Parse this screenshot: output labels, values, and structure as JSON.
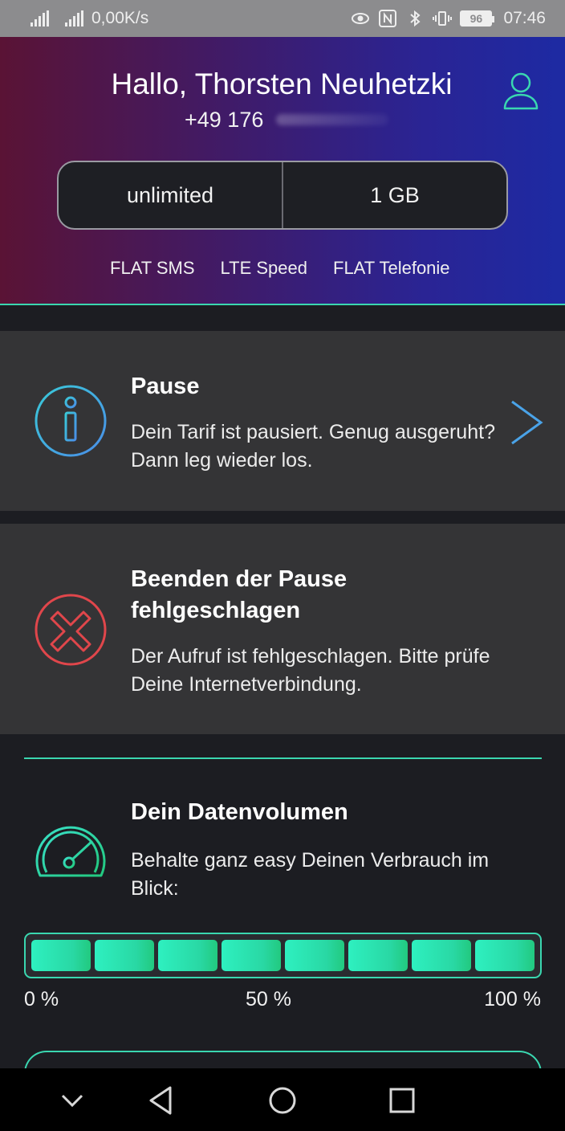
{
  "status_bar": {
    "speed": "0,00K/s",
    "battery": "96",
    "time": "07:46"
  },
  "header": {
    "greeting": "Hallo, Thorsten Neuhetzki",
    "phone": "+49 176",
    "plan": {
      "sms": "unlimited",
      "data": "1 GB"
    },
    "features": [
      "FLAT SMS",
      "LTE Speed",
      "FLAT Telefonie"
    ]
  },
  "cards": {
    "pause": {
      "title": "Pause",
      "text": "Dein Tarif ist pausiert. Genug ausgeruht? Dann leg wieder los."
    },
    "error": {
      "title": "Beenden der Pause fehlgeschlagen",
      "text": "Der Aufruf ist fehlgeschlagen. Bitte prüfe Deine Internetverbindung."
    }
  },
  "data_volume": {
    "title": "Dein Datenvolumen",
    "text": "Behalte ganz easy Deinen Verbrauch im Blick:",
    "remaining_percent": 100,
    "segments": 8,
    "labels": [
      "0 %",
      "50 %",
      "100 %"
    ]
  },
  "colors": {
    "accent": "#3ad7b0",
    "info": "#4aa3e8",
    "error": "#e0464b"
  },
  "icons": [
    "profile-icon",
    "info-icon",
    "chevron-right-icon",
    "error-x-icon",
    "speedometer-icon",
    "back-icon",
    "home-icon",
    "recents-icon",
    "chevron-down-icon"
  ]
}
